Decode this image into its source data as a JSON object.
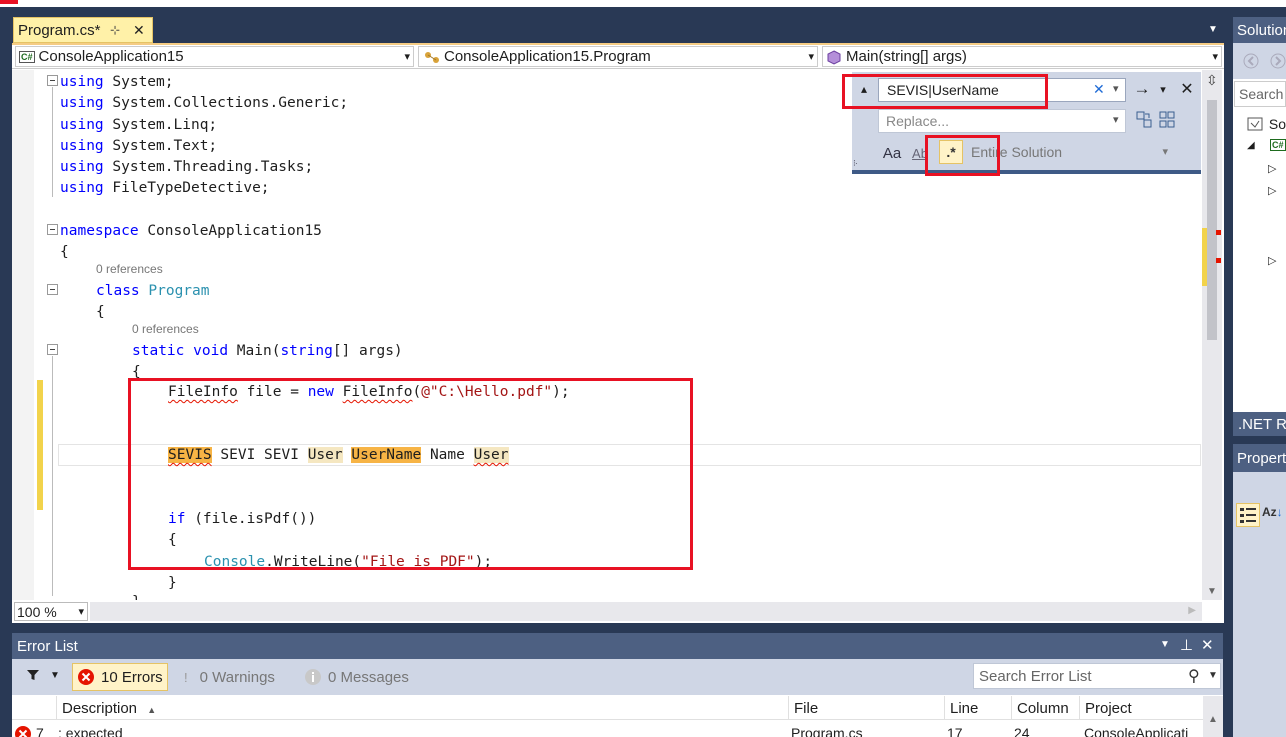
{
  "editor": {
    "tab_title": "Program.cs*",
    "tab_pin_glyph": "⊹",
    "tab_close_glyph": "✕",
    "tabs_overflow_glyph": "▼",
    "nav": {
      "project": "ConsoleApplication15",
      "project_icon_text": "C#",
      "class": "ConsoleApplication15.Program",
      "member": "Main(string[] args)"
    },
    "code": {
      "using_kw": "using",
      "using1": "System;",
      "using2": "System.Collections.Generic;",
      "using3": "System.Linq;",
      "using4": "System.Text;",
      "using5": "System.Threading.Tasks;",
      "using6": "FileTypeDetective;",
      "namespace_kw": "namespace",
      "namespace_name": "ConsoleApplication15",
      "open_brace": "{",
      "close_brace": "}",
      "refs": "0 references",
      "class_kw": "class",
      "class_name": "Program",
      "static_kw": "static",
      "void_kw": "void",
      "main_name": "Main(",
      "string_kw": "string",
      "main_args": "[] args)",
      "fileinfo_type": "FileInfo",
      "fileinfo_mid": " file = ",
      "new_kw": "new",
      "fileinfo_ctor": "FileInfo",
      "fileinfo_paren": "(",
      "fileinfo_path": "@\"C:\\Hello.pdf\"",
      "fileinfo_end": ");",
      "tokens": {
        "t1": "SEVIS",
        "t2": "SEVI",
        "t3": "SEVI",
        "t4": "User",
        "t5": "UserName",
        "t6": "Name",
        "t7": "User"
      },
      "if_kw": "if",
      "if_cond": " (file.isPdf())",
      "console_type": "Console",
      "writeline": ".WriteLine(",
      "writeline_str": "\"File is PDF\"",
      "writeline_end": ");",
      "partial_line": "}"
    },
    "zoom": "100 %",
    "dropdown_glyph": "▾"
  },
  "find": {
    "toggle_glyph": "▴",
    "search_value": "SEVIS|UserName",
    "clear_glyph": "✕",
    "dropdown_glyph": "▾",
    "next_glyph": "→",
    "close_glyph": "✕",
    "replace_placeholder": "Replace...",
    "match_case": "Aa",
    "whole_word": "Ab",
    "regex": ".*",
    "scope": "Entire Solution"
  },
  "error_list": {
    "title": "Error List",
    "errors": "10 Errors",
    "warnings": "0 Warnings",
    "messages": "0 Messages",
    "search_placeholder": "Search Error List",
    "columns": [
      "Description",
      "File",
      "Line",
      "Column",
      "Project"
    ],
    "sort_glyph": "▲",
    "row": {
      "code": "7",
      "description": "; expected",
      "file": "Program.cs",
      "line": "17",
      "column": "24",
      "project": "ConsoleApplicati"
    }
  },
  "solution": {
    "title": "Solution",
    "search": "Search",
    "root": "So",
    "net_panel": ".NET Re",
    "properties_panel": "Propert"
  }
}
